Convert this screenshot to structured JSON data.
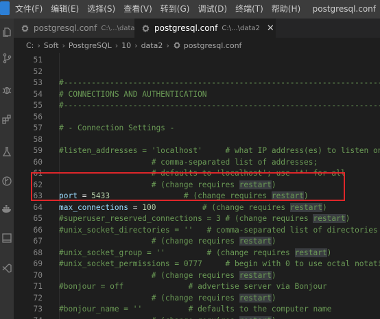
{
  "menu": [
    "文件(F)",
    "编辑(E)",
    "选择(S)",
    "查看(V)",
    "转到(G)",
    "调试(D)",
    "终端(T)",
    "帮助(H)"
  ],
  "window_title": "postgresql.conf",
  "activity_icons": [
    "files-icon",
    "source-control-icon",
    "debug-icon",
    "extensions-icon",
    "test-flask-icon",
    "git-graph-icon",
    "docker-icon",
    "panel-icon",
    "vscode-icon"
  ],
  "tabs": [
    {
      "name": "postgresql.conf",
      "path": "C:\\...\\data",
      "active": false
    },
    {
      "name": "postgresql.conf",
      "path": "C:\\...\\data2",
      "active": true,
      "close": "✕"
    }
  ],
  "breadcrumb": [
    "C:",
    "Soft",
    "PostgreSQL",
    "10",
    "data2",
    "postgresql.conf"
  ],
  "breadcrumb_sep": "›",
  "editor": {
    "lines": [
      {
        "n": "51",
        "text": ""
      },
      {
        "n": "52",
        "text": ""
      },
      {
        "n": "53",
        "text": "#------------------------------------------------------------------------------"
      },
      {
        "n": "54",
        "text": "# CONNECTIONS AND AUTHENTICATION"
      },
      {
        "n": "55",
        "text": "#------------------------------------------------------------------------------"
      },
      {
        "n": "56",
        "text": ""
      },
      {
        "n": "57",
        "text": "# - Connection Settings -"
      },
      {
        "n": "58",
        "text": ""
      },
      {
        "n": "59",
        "text": "#listen_addresses = 'localhost'     # what IP address(es) to listen on;"
      },
      {
        "n": "60",
        "text": "                    # comma-separated list of addresses;"
      },
      {
        "n": "61",
        "text": "                    # defaults to 'localhost'; use '*' for all"
      },
      {
        "n": "62",
        "pre": "                    # (change requires ",
        "hl": "restart",
        "post": ")"
      },
      {
        "n": "63",
        "kw": "port",
        "eq": " = ",
        "num": "5433",
        "pre": "                # (change requires ",
        "hl": "restart",
        "post": ")"
      },
      {
        "n": "64",
        "kw": "max_connections",
        "eq": " = ",
        "num": "100",
        "pre": "          # (change requires ",
        "hl": "restart",
        "post": ")"
      },
      {
        "n": "65",
        "pre": "#superuser_reserved_connections = 3 # (change requires ",
        "hl": "restart",
        "post": ")"
      },
      {
        "n": "66",
        "text": "#unix_socket_directories = ''   # comma-separated list of directories"
      },
      {
        "n": "67",
        "pre": "                    # (change requires ",
        "hl": "restart",
        "post": ")"
      },
      {
        "n": "68",
        "pre": "#unix_socket_group = ''         # (change requires ",
        "hl": "restart",
        "post": ")"
      },
      {
        "n": "69",
        "text": "#unix_socket_permissions = 0777     # begin with 0 to use octal notation"
      },
      {
        "n": "70",
        "pre": "                    # (change requires ",
        "hl": "restart",
        "post": ")"
      },
      {
        "n": "71",
        "text": "#bonjour = off              # advertise server via Bonjour"
      },
      {
        "n": "72",
        "pre": "                    # (change requires ",
        "hl": "restart",
        "post": ")"
      },
      {
        "n": "73",
        "text": "#bonjour_name = ''          # defaults to the computer name"
      },
      {
        "n": "74",
        "pre": "                    # (change requires ",
        "hl": "restart",
        "post": ")"
      }
    ]
  },
  "colors": {
    "comment": "#6a9955",
    "keyword": "#9cdcfe",
    "number": "#b5cea8",
    "annotation_box": "#e0262a"
  }
}
